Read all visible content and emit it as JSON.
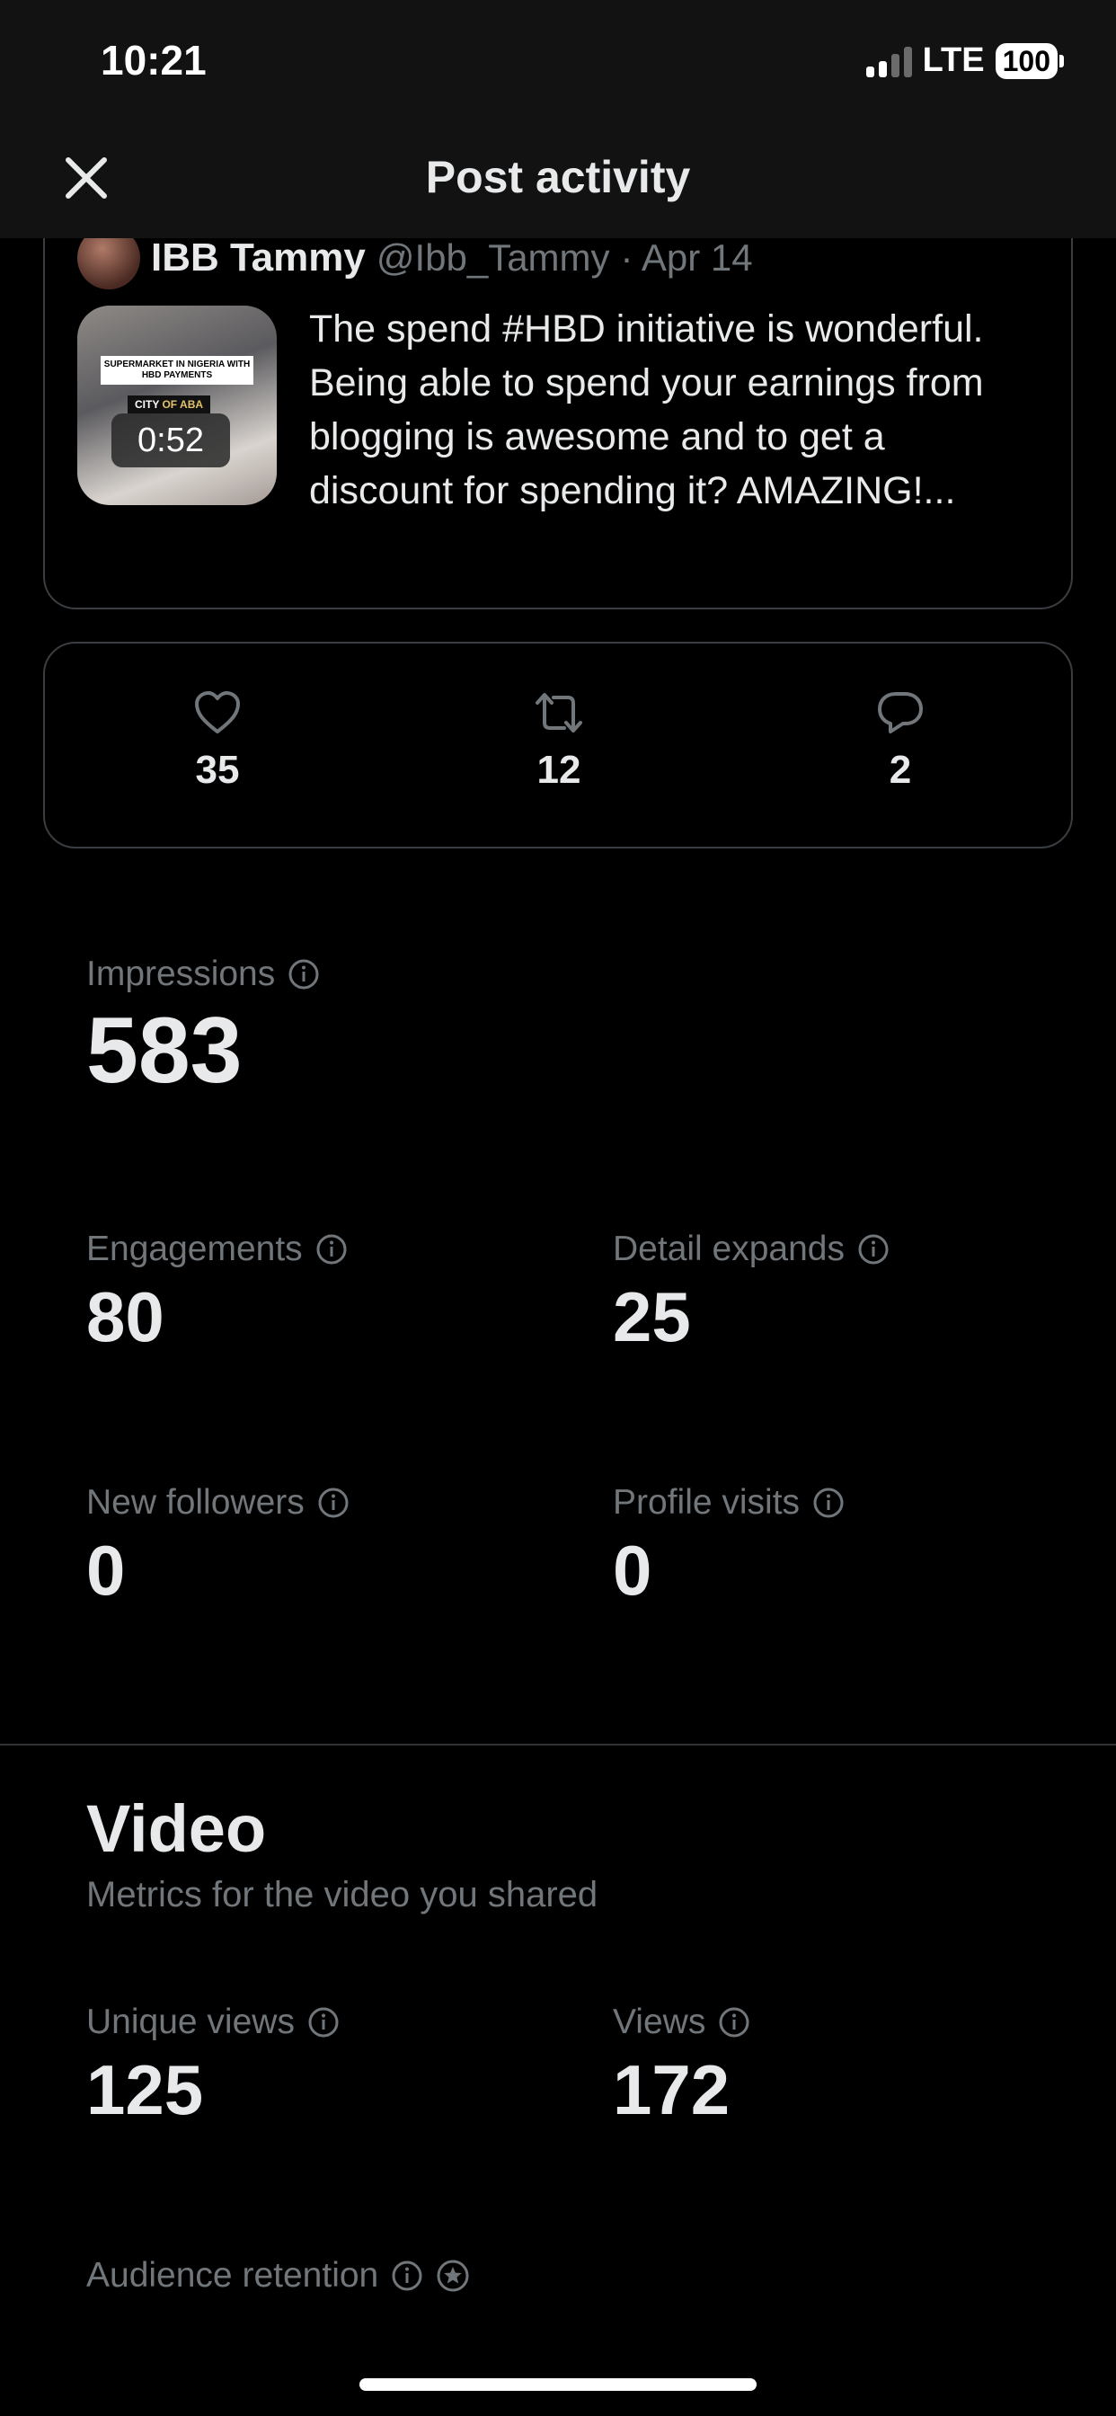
{
  "status_bar": {
    "time": "10:21",
    "network": "LTE",
    "battery": "100"
  },
  "header": {
    "title": "Post activity"
  },
  "post": {
    "author_name": "IBB Tammy",
    "author_handle": "@Ibb_Tammy",
    "date": "· Apr 14",
    "thumbnail_banner": "SUPERMARKET IN NIGERIA WITH HBD PAYMENTS",
    "thumbnail_city": "CITY",
    "thumbnail_city_accent": "OF ABA",
    "video_duration": "0:52",
    "text": "The spend #HBD initiative is wonderful. Being able to spend your earnings from blogging is awesome and to get a discount for spending it? AMAZING!..."
  },
  "engagement": {
    "likes": "35",
    "reposts": "12",
    "replies": "2"
  },
  "metrics": {
    "impressions": {
      "label": "Impressions",
      "value": "583"
    },
    "engagements": {
      "label": "Engagements",
      "value": "80"
    },
    "detail_expands": {
      "label": "Detail expands",
      "value": "25"
    },
    "new_followers": {
      "label": "New followers",
      "value": "0"
    },
    "profile_visits": {
      "label": "Profile visits",
      "value": "0"
    }
  },
  "video": {
    "title": "Video",
    "subtitle": "Metrics for the video you shared",
    "unique_views": {
      "label": "Unique views",
      "value": "125"
    },
    "views": {
      "label": "Views",
      "value": "172"
    },
    "audience_retention": {
      "label": "Audience retention"
    }
  },
  "colors": {
    "background": "#000000",
    "text": "#e7e9ea",
    "muted": "#71767b",
    "border": "#3a3d41"
  },
  "icons": [
    "close-icon",
    "heart-icon",
    "repost-icon",
    "reply-icon",
    "info-icon",
    "premium-icon"
  ]
}
